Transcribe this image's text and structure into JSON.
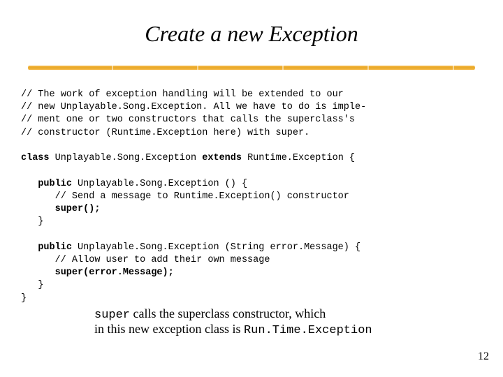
{
  "title": "Create a new Exception",
  "comment_lines": [
    "// The work of exception handling will be extended to our",
    "// new Unplayable.Song.Exception. All we have to do is imple-",
    "// ment one or two constructors that calls the superclass's",
    "// constructor (Runtime.Exception here) with super."
  ],
  "class_decl": {
    "kw_class": "class",
    "name": " Unplayable.Song.Exception ",
    "kw_extends": "extends",
    "parent": " Runtime.Exception {"
  },
  "ctor1": {
    "kw_public": "public",
    "sig": " Unplayable.Song.Exception () {",
    "comment": "// Send a message to Runtime.Exception() constructor",
    "kw_super": "super();",
    "close": "}"
  },
  "ctor2": {
    "kw_public": "public",
    "sig": " Unplayable.Song.Exception (String error.Message) {",
    "comment": "// Allow user to add their own message",
    "kw_super": "super(error.Message);",
    "close": "}"
  },
  "class_close": "}",
  "caption": {
    "part1": "super",
    "part2": " calls the superclass constructor, which",
    "line2a": "in this new exception class is ",
    "line2b": "Run.Time.Exception"
  },
  "pagenum": "12"
}
